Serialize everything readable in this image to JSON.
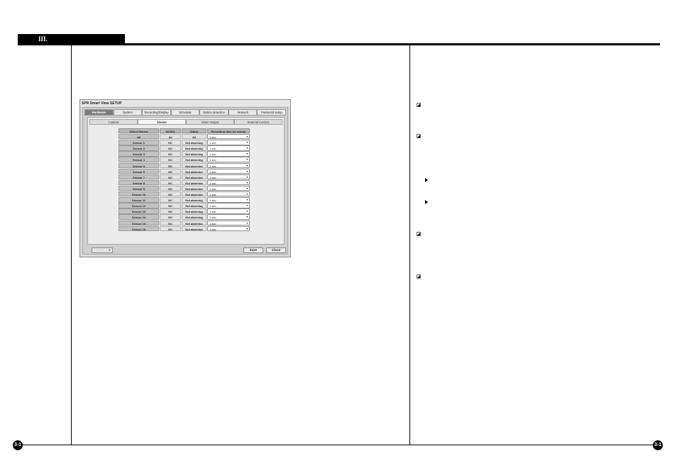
{
  "header": {
    "chapter": "III."
  },
  "footer": {
    "left_page": "3-1",
    "right_page": "3-1"
  },
  "window": {
    "title": "SPR Smart View SETUP",
    "main_tabs": [
      "Hardware",
      "System",
      "Recording/Display",
      "Schedule",
      "Motion detection",
      "Network",
      "Password setup"
    ],
    "sub_tabs": [
      "Camera",
      "Sensor",
      "Alarm Output",
      "External monitor"
    ],
    "columns": [
      "Select Sensor",
      "NC/NO",
      "Alarm",
      "Recording time by sensor"
    ],
    "all_row": [
      "All",
      "All",
      "All",
      "1 sec"
    ],
    "rows": [
      {
        "name": "Sensor 1",
        "nc": "NC",
        "alarm": "Not alarming",
        "time": "1 sec"
      },
      {
        "name": "Sensor 2",
        "nc": "NC",
        "alarm": "Not alarming",
        "time": "1 sec"
      },
      {
        "name": "Sensor 3",
        "nc": "NC",
        "alarm": "Not alarming",
        "time": "1 sec"
      },
      {
        "name": "Sensor 4",
        "nc": "NC",
        "alarm": "Not alarming",
        "time": "1 sec"
      },
      {
        "name": "Sensor 5",
        "nc": "NC",
        "alarm": "Not alarming",
        "time": "1 sec"
      },
      {
        "name": "Sensor 6",
        "nc": "NC",
        "alarm": "Not alarming",
        "time": "1 sec"
      },
      {
        "name": "Sensor 7",
        "nc": "NC",
        "alarm": "Not alarming",
        "time": "1 sec"
      },
      {
        "name": "Sensor 8",
        "nc": "NC",
        "alarm": "Not alarming",
        "time": "1 sec"
      },
      {
        "name": "Sensor 9",
        "nc": "NC",
        "alarm": "Not alarming",
        "time": "1 sec"
      },
      {
        "name": "Sensor 10",
        "nc": "NC",
        "alarm": "Not alarming",
        "time": "1 sec"
      },
      {
        "name": "Sensor 11",
        "nc": "NC",
        "alarm": "Not alarming",
        "time": "1 sec"
      },
      {
        "name": "Sensor 12",
        "nc": "NC",
        "alarm": "Not alarming",
        "time": "1 sec"
      },
      {
        "name": "Sensor 13",
        "nc": "NC",
        "alarm": "Not alarming",
        "time": "1 sec"
      },
      {
        "name": "Sensor 14",
        "nc": "NC",
        "alarm": "Not alarming",
        "time": "1 sec"
      },
      {
        "name": "Sensor 15",
        "nc": "NC",
        "alarm": "Not alarming",
        "time": "1 sec"
      },
      {
        "name": "Sensor 16",
        "nc": "NC",
        "alarm": "Not alarming",
        "time": "1 sec"
      }
    ],
    "language_value": "",
    "save_label": "Save",
    "close_label": "Close"
  },
  "right_column": {
    "bullet_icon": "note-pointer-icon",
    "arrow_icon": "triangle-right-icon"
  }
}
